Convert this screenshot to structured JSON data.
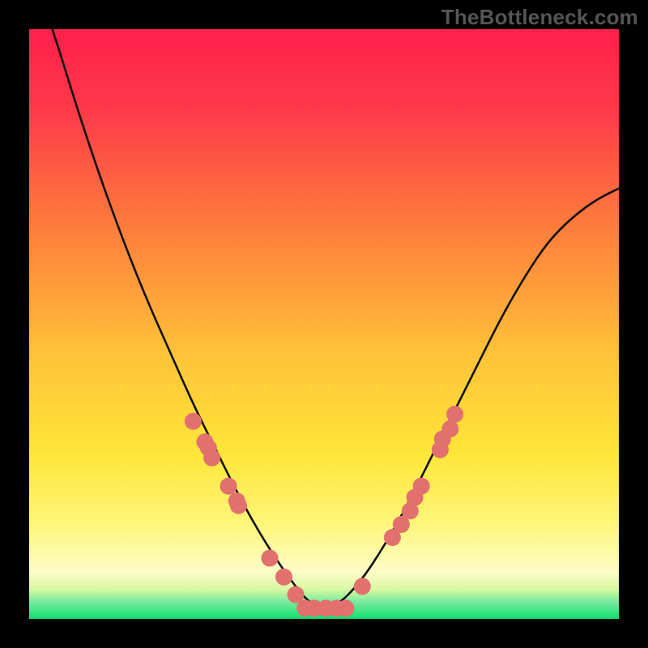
{
  "watermark": "TheBottleneck.com",
  "colors": {
    "bg_black": "#000000",
    "bg_top": "#ff1f4b",
    "bg_mid": "#ffe038",
    "bg_low_yellow": "#fff79a",
    "bg_strip_green": "#11e071",
    "curve": "#111111",
    "dot_fill": "#e2706f",
    "dot_stroke": "#b34b4b"
  },
  "chart_data": {
    "type": "line",
    "title": "",
    "xlabel": "",
    "ylabel": "",
    "xlim": [
      0,
      1
    ],
    "ylim": [
      0,
      1
    ],
    "series": [
      {
        "name": "bottleneck-curve",
        "x": [
          0.0,
          0.04,
          0.08,
          0.12,
          0.16,
          0.2,
          0.24,
          0.28,
          0.32,
          0.36,
          0.4,
          0.44,
          0.48,
          0.52,
          0.56,
          0.6,
          0.64,
          0.68,
          0.72,
          0.76,
          0.8,
          0.84,
          0.88,
          0.92,
          0.96,
          1.0
        ],
        "y": [
          1.11,
          1.0,
          0.87,
          0.75,
          0.64,
          0.54,
          0.45,
          0.36,
          0.28,
          0.2,
          0.13,
          0.07,
          0.02,
          0.02,
          0.06,
          0.12,
          0.19,
          0.27,
          0.35,
          0.43,
          0.51,
          0.58,
          0.64,
          0.68,
          0.71,
          0.73
        ]
      }
    ],
    "dots": [
      {
        "x": 0.278,
        "y": 0.335
      },
      {
        "x": 0.298,
        "y": 0.3
      },
      {
        "x": 0.304,
        "y": 0.29
      },
      {
        "x": 0.31,
        "y": 0.273
      },
      {
        "x": 0.338,
        "y": 0.225
      },
      {
        "x": 0.352,
        "y": 0.2
      },
      {
        "x": 0.355,
        "y": 0.192
      },
      {
        "x": 0.408,
        "y": 0.103
      },
      {
        "x": 0.432,
        "y": 0.071
      },
      {
        "x": 0.452,
        "y": 0.041
      },
      {
        "x": 0.468,
        "y": 0.018
      },
      {
        "x": 0.484,
        "y": 0.018
      },
      {
        "x": 0.503,
        "y": 0.018
      },
      {
        "x": 0.521,
        "y": 0.018
      },
      {
        "x": 0.537,
        "y": 0.018
      },
      {
        "x": 0.565,
        "y": 0.055
      },
      {
        "x": 0.616,
        "y": 0.138
      },
      {
        "x": 0.631,
        "y": 0.16
      },
      {
        "x": 0.646,
        "y": 0.183
      },
      {
        "x": 0.654,
        "y": 0.206
      },
      {
        "x": 0.665,
        "y": 0.225
      },
      {
        "x": 0.697,
        "y": 0.287
      },
      {
        "x": 0.701,
        "y": 0.305
      },
      {
        "x": 0.714,
        "y": 0.322
      },
      {
        "x": 0.722,
        "y": 0.347
      }
    ]
  }
}
